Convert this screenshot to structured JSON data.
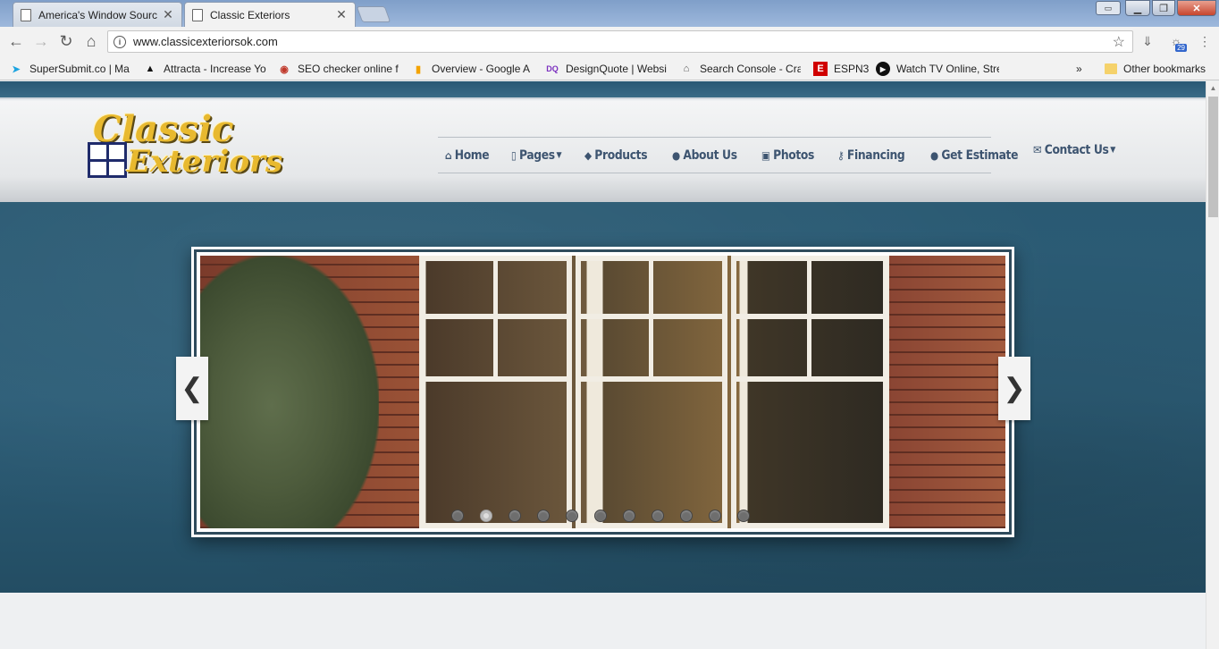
{
  "browser": {
    "tabs": [
      {
        "title": "America's Window Sourc"
      },
      {
        "title": "Classic Exteriors"
      }
    ],
    "url": "www.classicexteriorsok.com",
    "bookmarks": [
      {
        "label": "SuperSubmit.co | Ma",
        "icon": "supersubmit-icon",
        "color": "#1aa3e0"
      },
      {
        "label": "Attracta - Increase Yo",
        "icon": "attracta-icon",
        "color": "#111111"
      },
      {
        "label": "SEO checker online fr",
        "icon": "seo-checker-icon",
        "color": "#c0392b"
      },
      {
        "label": "Overview - Google A",
        "icon": "analytics-icon",
        "color": "#f4a300"
      },
      {
        "label": "DesignQuote | Websi",
        "icon": "designquote-icon",
        "color": "#7b2fbf"
      },
      {
        "label": "Search Console - Cra",
        "icon": "search-console-icon",
        "color": "#555555"
      },
      {
        "label": "ESPN3",
        "icon": "espn-icon",
        "color": "#d00000"
      },
      {
        "label": "Watch TV Online, Stre",
        "icon": "watch-tv-icon",
        "color": "#111111"
      }
    ],
    "bookmarks_overflow": "»",
    "other_bookmarks": "Other bookmarks"
  },
  "site": {
    "logo": {
      "line1": "Classic",
      "line2": "Exteriors"
    },
    "nav": [
      {
        "label": "Home",
        "icon": "home-icon"
      },
      {
        "label": "Pages",
        "icon": "file-icon",
        "dropdown": true
      },
      {
        "label": "Products",
        "icon": "tags-icon"
      },
      {
        "label": "About Us",
        "icon": "user-icon"
      },
      {
        "label": "Photos",
        "icon": "picture-icon"
      },
      {
        "label": "Financing",
        "icon": "key-icon"
      },
      {
        "label": "Get Estimate",
        "icon": "comment-icon"
      }
    ],
    "contact": {
      "label": "Contact Us",
      "icon": "envelope-icon",
      "dropdown": true
    },
    "slider": {
      "slide_count": 11,
      "active_slide": 2,
      "prev_glyph": "❮",
      "next_glyph": "❯"
    }
  },
  "colors": {
    "nav_text": "#3d5470",
    "hero_bg": "#2a5a73",
    "logo_gold": "#e8b92f",
    "logo_navy": "#1f2b6b"
  }
}
